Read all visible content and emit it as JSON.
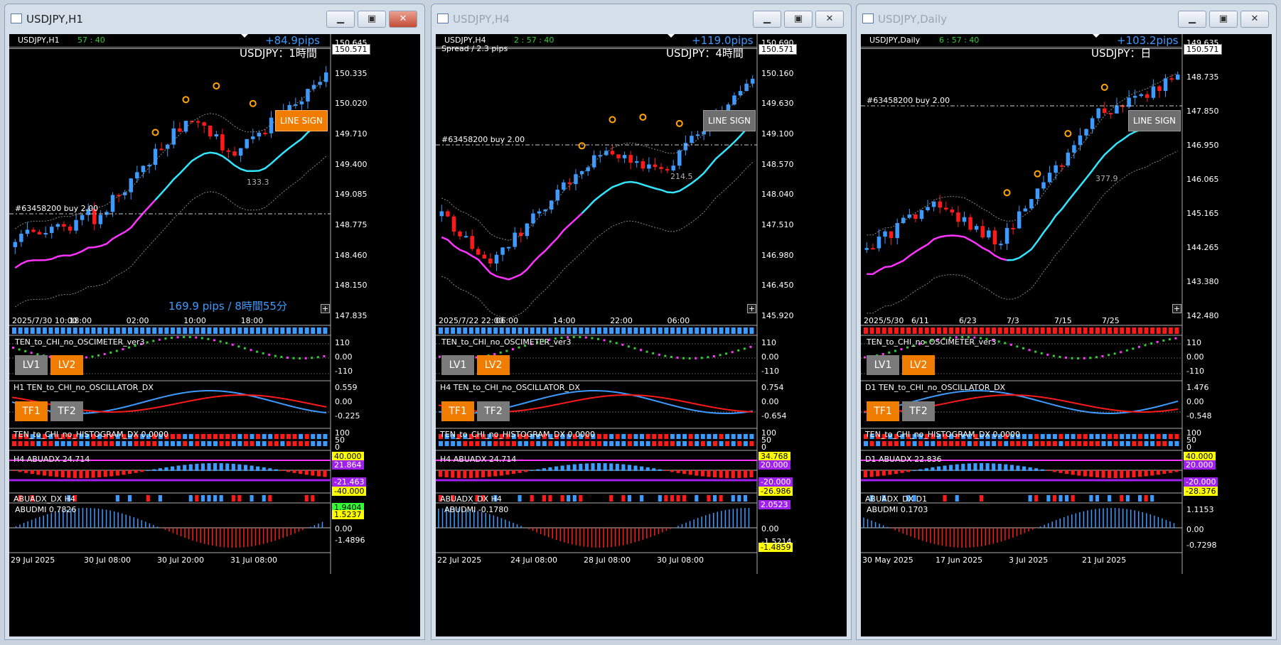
{
  "windows": [
    {
      "title": "USDJPY,H1",
      "symbol_label": "USDJPY,H1",
      "countdown": "57 : 40",
      "pips": "+84.9pips",
      "big_label": "USDJPY：1時間",
      "current_price": "150.571",
      "buy_label": "#63458200 buy 2.00",
      "line_sign": "LINE SIGN",
      "side_value": "133.3",
      "summary": "169.9 pips / 8時間55分",
      "price_axis": [
        "150.645",
        "150.335",
        "150.020",
        "149.710",
        "149.400",
        "149.085",
        "148.775",
        "148.460",
        "148.150",
        "147.835"
      ],
      "time_axis": [
        "2025/7/30 10:00",
        "18:00",
        "02:00",
        "10:00",
        "18:00"
      ],
      "osc1_title": "TEN_to_CHI_no_OSCIMETER_ver3",
      "osc1_axis": [
        "110",
        "0.00",
        "-110"
      ],
      "lv1": "LV1",
      "lv2": "LV2",
      "osc2_title": "H1 TEN_to_CHI_no_OSCILLATOR_DX",
      "osc2_axis": [
        "0.559",
        "0.00",
        "-0.225"
      ],
      "tf1": "TF1",
      "tf2": "TF2",
      "hist_title": "TEN_to_CHI_no_HISTOGRAM_DX 0.0000",
      "hist_axis": [
        "100",
        "50",
        "0"
      ],
      "abuadx_title": "H4 ABUADX  24.714",
      "abuadx_boxes": [
        "40.000",
        "21.864",
        "-21.463",
        "-40.000"
      ],
      "abuadx_dx_title": "ABUADX_DX H4",
      "abudmi_title": "ABUDMI  0.7826",
      "abudmi_boxes": [
        "1.9404",
        "1.5237"
      ],
      "abudmi_axis": [
        "0.00",
        "-1.4896"
      ],
      "date_axis": [
        "29 Jul 2025",
        "30 Jul 08:00",
        "30 Jul 20:00",
        "31 Jul 08:00"
      ]
    },
    {
      "title": "USDJPY,H4",
      "symbol_label": "USDJPY,H4",
      "countdown": "2 : 57 : 40",
      "pips": "+119.0pips",
      "spread": "Spread / 2.3 pips",
      "big_label": "USDJPY：4時間",
      "current_price": "150.571",
      "buy_label": "#63458200 buy 2.00",
      "line_sign": "LINE SIGN",
      "side_value": "214.5",
      "price_axis": [
        "150.690",
        "150.160",
        "149.630",
        "149.100",
        "148.570",
        "148.040",
        "147.510",
        "146.980",
        "146.450",
        "145.920"
      ],
      "time_axis": [
        "2025/7/22 22:00",
        "06:00",
        "14:00",
        "22:00",
        "06:00"
      ],
      "osc1_title": "TEN_to_CHI_no_OSCIMETER_ver3",
      "osc1_axis": [
        "110",
        "0.00",
        "-110"
      ],
      "lv1": "LV1",
      "lv2": "LV2",
      "osc2_title": "H4 TEN_to_CHI_no_OSCILLATOR_DX",
      "osc2_axis": [
        "0.754",
        "0.00",
        "-0.654"
      ],
      "tf1": "TF1",
      "tf2": "TF2",
      "hist_title": "TEN_to_CHI_no_HISTOGRAM_DX 0.0000",
      "hist_axis": [
        "100",
        "50",
        "0"
      ],
      "abuadx_title": "H4 ABUADX  24.714",
      "abuadx_boxes": [
        "34.768",
        "20.000",
        "-20.000",
        "-26.986"
      ],
      "abuadx_dx_title": "ABUADX_DX H4",
      "abudmi_title": "ABUDMI  -0.1780",
      "abudmi_boxes": [
        "2.0523",
        "-1.4859"
      ],
      "abudmi_axis": [
        "0.00",
        "-1.5214"
      ],
      "date_axis": [
        "22 Jul 2025",
        "24 Jul 08:00",
        "28 Jul 08:00",
        "30 Jul 08:00"
      ]
    },
    {
      "title": "USDJPY,Daily",
      "symbol_label": "USDJPY,Daily",
      "countdown": "6 : 57 : 40",
      "pips": "+103.2pips",
      "big_label": "USDJPY：日",
      "current_price": "150.571",
      "buy_label": "#63458200 buy 2.00",
      "line_sign": "LINE SIGN",
      "side_value": "377.9",
      "price_axis": [
        "149.635",
        "148.735",
        "147.850",
        "146.950",
        "146.065",
        "145.165",
        "144.265",
        "143.380",
        "142.480"
      ],
      "time_axis": [
        "2025/5/30",
        "6/11",
        "6/23",
        "7/3",
        "7/15",
        "7/25"
      ],
      "osc1_title": "TEN_to_CHI_no_OSCIMETER_ver3",
      "osc1_axis": [
        "110",
        "0.00",
        "-110"
      ],
      "lv1": "LV1",
      "lv2": "LV2",
      "osc2_title": "D1 TEN_to_CHI_no_OSCILLATOR_DX",
      "osc2_axis": [
        "1.476",
        "0.00",
        "-0.548"
      ],
      "tf1": "TF1",
      "tf2": "TF2",
      "hist_title": "TEN_to_CHI_no_HISTOGRAM_DX 0.0000",
      "hist_axis": [
        "100",
        "50",
        "0"
      ],
      "abuadx_title": "D1 ABUADX  22.836",
      "abuadx_boxes": [
        "40.000",
        "20.000",
        "-20.000",
        "-28.376"
      ],
      "abuadx_dx_title": "ABUADX_DX D1",
      "abudmi_title": "ABUDMI  0.1703",
      "abudmi_boxes": [],
      "abudmi_axis": [
        "1.1153",
        "0.00",
        "-0.7298"
      ],
      "date_axis": [
        "30 May 2025",
        "17 Jun 2025",
        "3 Jul 2025",
        "21 Jul 2025"
      ]
    }
  ],
  "icons": {
    "minimize": "minimize-icon",
    "maximize": "maximize-icon",
    "close": "close-icon",
    "app": "chart-window-icon"
  },
  "colors": {
    "bull": "#3d9bff",
    "bear": "#ff1a1a",
    "ma_cyan": "#33e6ff",
    "ma_magenta": "#ff33ff",
    "pips": "#3d9bff",
    "line_sign_active": "#f07d00"
  }
}
